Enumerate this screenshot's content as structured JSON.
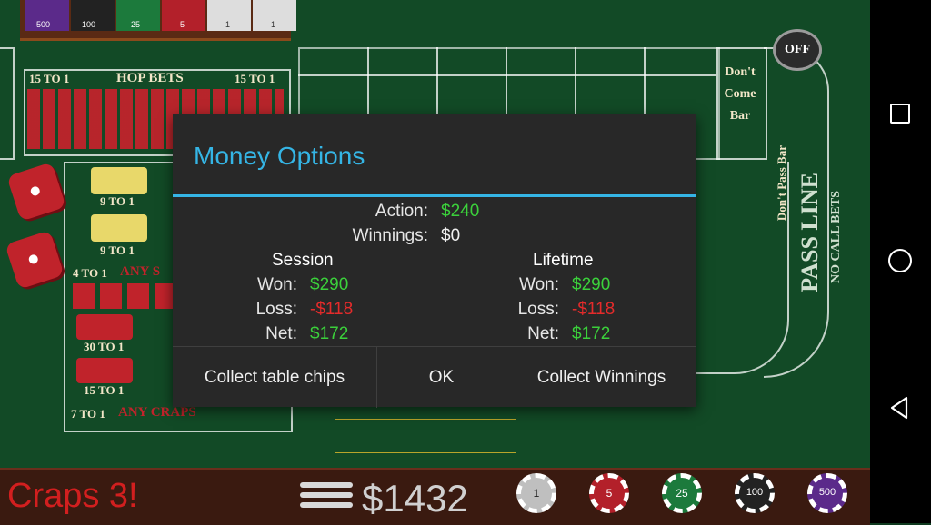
{
  "table": {
    "hop_bets_label": "HOP BETS",
    "odds_15_to_1": "15 TO 1",
    "odds_9_to_1": "9 TO 1",
    "odds_30_to_1": "30 TO 1",
    "odds_4_to_1": "4 TO 1",
    "odds_7_to_1": "7 TO 1",
    "any_craps": "ANY CRAPS",
    "any_seven": "ANY S",
    "dont_come_bar": "Don't Come Bar",
    "dont_pass_bar": "Don't Pass Bar",
    "pass_line": "PASS LINE",
    "no_call_bets": "NO CALL BETS",
    "off_puck": "OFF",
    "chip_values_top": [
      "500",
      "100",
      "25",
      "5",
      "1",
      "1"
    ]
  },
  "dialog": {
    "title": "Money Options",
    "action_label": "Action:",
    "action_value": "$240",
    "winnings_label": "Winnings:",
    "winnings_value": "$0",
    "session": {
      "header": "Session",
      "won_label": "Won:",
      "won_value": "$290",
      "loss_label": "Loss:",
      "loss_value": "-$118",
      "net_label": "Net:",
      "net_value": "$172"
    },
    "lifetime": {
      "header": "Lifetime",
      "won_label": "Won:",
      "won_value": "$290",
      "loss_label": "Loss:",
      "loss_value": "-$118",
      "net_label": "Net:",
      "net_value": "$172"
    },
    "buttons": {
      "collect_chips": "Collect table chips",
      "ok": "OK",
      "collect_winnings": "Collect Winnings"
    }
  },
  "bottom_bar": {
    "app_title": "Craps 3!",
    "bankroll": "$1432",
    "chips": [
      "1",
      "5",
      "25",
      "100",
      "500"
    ]
  },
  "colors": {
    "accent": "#35b5e5",
    "positive": "#3bd13b",
    "negative": "#e52b2b",
    "felt": "#124a26"
  },
  "nav": {
    "icons": [
      "square-icon",
      "circle-icon",
      "triangle-back-icon"
    ]
  }
}
